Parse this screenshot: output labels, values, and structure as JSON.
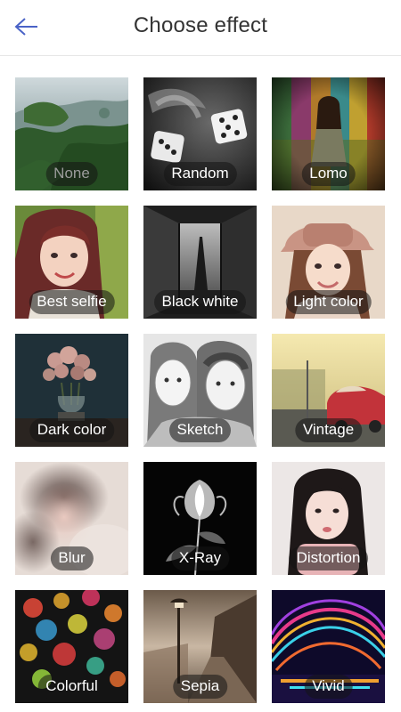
{
  "header": {
    "title": "Choose effect",
    "back_icon": "arrow-left-icon",
    "accent_color": "#4a63c7"
  },
  "effects": [
    {
      "label": "None",
      "selected": true
    },
    {
      "label": "Random"
    },
    {
      "label": "Lomo"
    },
    {
      "label": "Best selfie"
    },
    {
      "label": "Black white"
    },
    {
      "label": "Light color"
    },
    {
      "label": "Dark color"
    },
    {
      "label": "Sketch"
    },
    {
      "label": "Vintage"
    },
    {
      "label": "Blur"
    },
    {
      "label": "X-Ray"
    },
    {
      "label": "Distortion"
    },
    {
      "label": "Colorful"
    },
    {
      "label": "Sepia"
    },
    {
      "label": "Vivid"
    }
  ]
}
